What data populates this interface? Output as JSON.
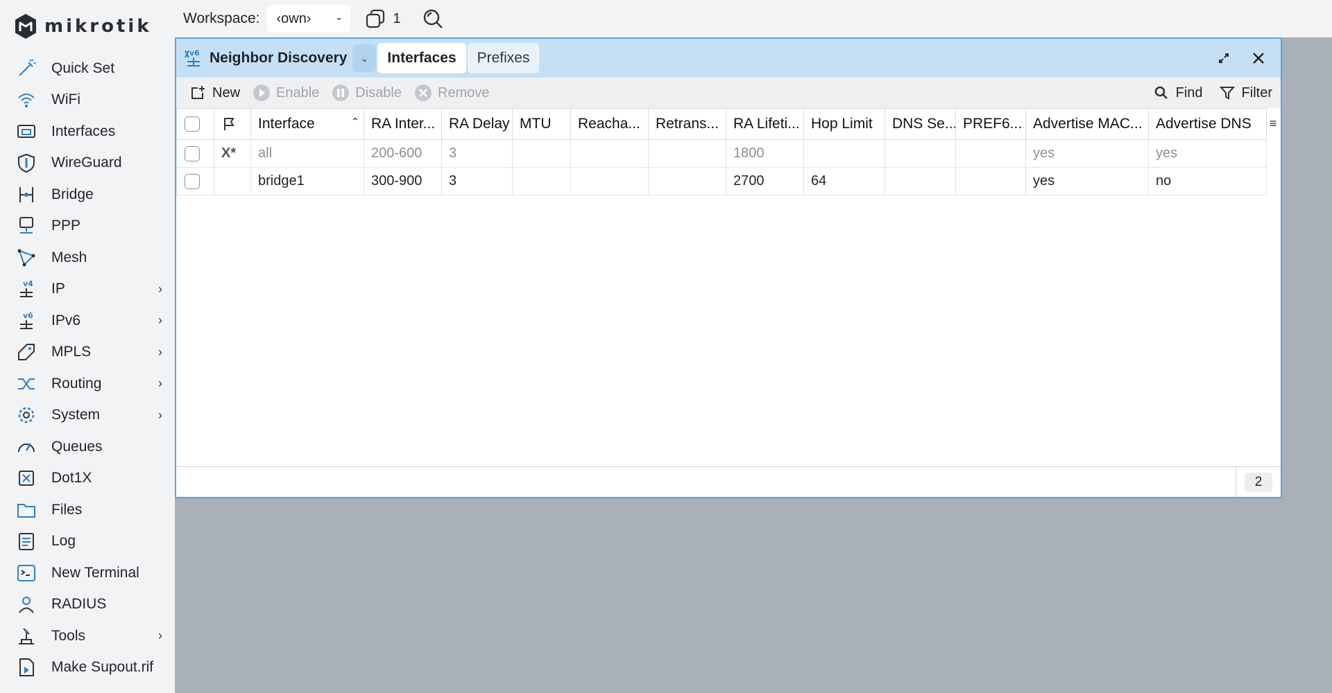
{
  "app": {
    "brand": "MikroTik",
    "logo_text": "mikrotik"
  },
  "sidebar": {
    "items": [
      {
        "label": "Quick Set",
        "icon": "wand-icon",
        "has_submenu": false
      },
      {
        "label": "WiFi",
        "icon": "wifi-icon",
        "has_submenu": false
      },
      {
        "label": "Interfaces",
        "icon": "interfaces-icon",
        "has_submenu": false
      },
      {
        "label": "WireGuard",
        "icon": "shield-icon",
        "has_submenu": false
      },
      {
        "label": "Bridge",
        "icon": "bridge-icon",
        "has_submenu": false
      },
      {
        "label": "PPP",
        "icon": "ppp-icon",
        "has_submenu": false
      },
      {
        "label": "Mesh",
        "icon": "mesh-icon",
        "has_submenu": false
      },
      {
        "label": "IP",
        "icon": "ip-v4-icon",
        "has_submenu": true
      },
      {
        "label": "IPv6",
        "icon": "ip-v6-icon",
        "has_submenu": true
      },
      {
        "label": "MPLS",
        "icon": "tag-icon",
        "has_submenu": true
      },
      {
        "label": "Routing",
        "icon": "routing-icon",
        "has_submenu": true
      },
      {
        "label": "System",
        "icon": "gear-icon",
        "has_submenu": true
      },
      {
        "label": "Queues",
        "icon": "gauge-icon",
        "has_submenu": false
      },
      {
        "label": "Dot1X",
        "icon": "dot1x-icon",
        "has_submenu": false
      },
      {
        "label": "Files",
        "icon": "folder-icon",
        "has_submenu": false
      },
      {
        "label": "Log",
        "icon": "log-icon",
        "has_submenu": false
      },
      {
        "label": "New Terminal",
        "icon": "terminal-icon",
        "has_submenu": false
      },
      {
        "label": "RADIUS",
        "icon": "radius-icon",
        "has_submenu": false
      },
      {
        "label": "Tools",
        "icon": "tools-icon",
        "has_submenu": true
      },
      {
        "label": "Make Supout.rif",
        "icon": "supout-icon",
        "has_submenu": false
      }
    ],
    "chevron": "›"
  },
  "topbar": {
    "workspace_label": "Workspace:",
    "workspace_value": "‹own›",
    "windows_count": "1"
  },
  "window": {
    "title": "Neighbor Discovery",
    "tabs": [
      {
        "label": "Interfaces",
        "active": true
      },
      {
        "label": "Prefixes",
        "active": false
      }
    ],
    "toolbar": {
      "new": "New",
      "enable": "Enable",
      "disable": "Disable",
      "remove": "Remove",
      "find": "Find",
      "filter": "Filter"
    },
    "table": {
      "columns": [
        "Interface",
        "RA Inter...",
        "RA Delay",
        "MTU",
        "Reacha...",
        "Retrans...",
        "RA Lifeti...",
        "Hop Limit",
        "DNS Se...",
        "PREF6...",
        "Advertise MAC...",
        "Advertise DNS"
      ],
      "rows": [
        {
          "flags": "X*",
          "disabled": true,
          "cells": [
            "all",
            "200-600",
            "3",
            "",
            "",
            "",
            "1800",
            "",
            "",
            "",
            "yes",
            "yes"
          ]
        },
        {
          "flags": "",
          "disabled": false,
          "cells": [
            "bridge1",
            "300-900",
            "3",
            "",
            "",
            "",
            "2700",
            "64",
            "",
            "",
            "yes",
            "no"
          ]
        }
      ]
    },
    "status": {
      "count": "2"
    }
  },
  "colors": {
    "accent": "#2b7fc4",
    "titlebar": "#c5e0f5",
    "border": "#5aa3dd"
  }
}
